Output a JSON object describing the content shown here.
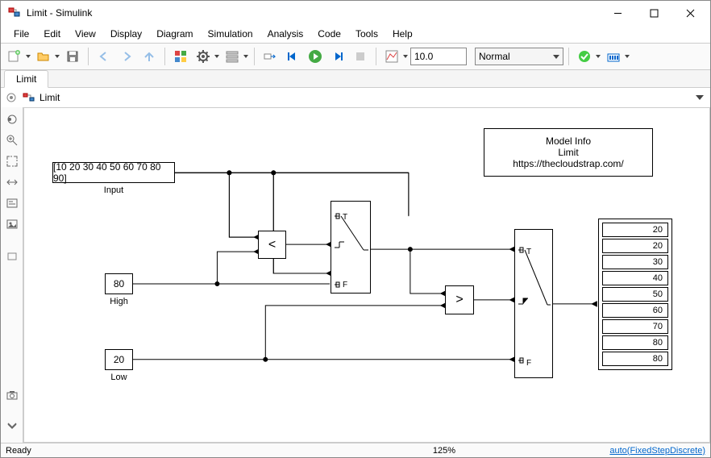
{
  "window": {
    "title": "Limit - Simulink"
  },
  "menu": {
    "file": "File",
    "edit": "Edit",
    "view": "View",
    "display": "Display",
    "diagram": "Diagram",
    "simulation": "Simulation",
    "analysis": "Analysis",
    "code": "Code",
    "tools": "Tools",
    "help": "Help"
  },
  "toolbar": {
    "stop_time": "10.0",
    "mode": "Normal"
  },
  "tabs": {
    "main": "Limit"
  },
  "breadcrumb": {
    "model": "Limit"
  },
  "blocks": {
    "input": {
      "label": "Input",
      "value": "[10 20 30 40 50 60 70 80 90]"
    },
    "high": {
      "label": "High",
      "value": "80"
    },
    "low": {
      "label": "Low",
      "value": "20"
    },
    "compare1": {
      "op": "<"
    },
    "compare2": {
      "op": ">"
    },
    "switch1": {
      "t": "T",
      "f": "F"
    },
    "switch2": {
      "t": "T",
      "f": "F"
    }
  },
  "display": {
    "values": [
      "20",
      "20",
      "30",
      "40",
      "50",
      "60",
      "70",
      "80",
      "80"
    ]
  },
  "modelinfo": {
    "title": "Model Info",
    "name": "Limit",
    "url": "https://thecloudstrap.com/"
  },
  "status": {
    "ready": "Ready",
    "zoom": "125%",
    "solver": "auto(FixedStepDiscrete)"
  }
}
